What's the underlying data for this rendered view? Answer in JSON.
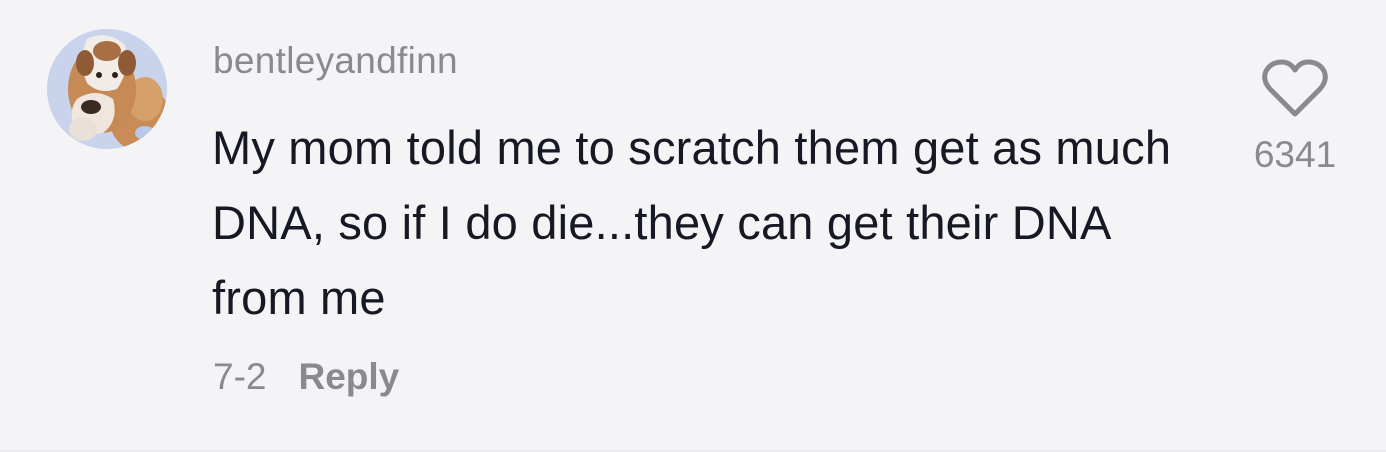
{
  "comment": {
    "avatar_icon": "bulldog-avatar",
    "username": "bentleyandfinn",
    "text": "My mom told me to scratch them get as much DNA, so if I do die...they can get their DNA from me",
    "date": "7-2",
    "reply_label": "Reply",
    "like_icon": "heart-outline-icon",
    "like_count": "6341"
  }
}
